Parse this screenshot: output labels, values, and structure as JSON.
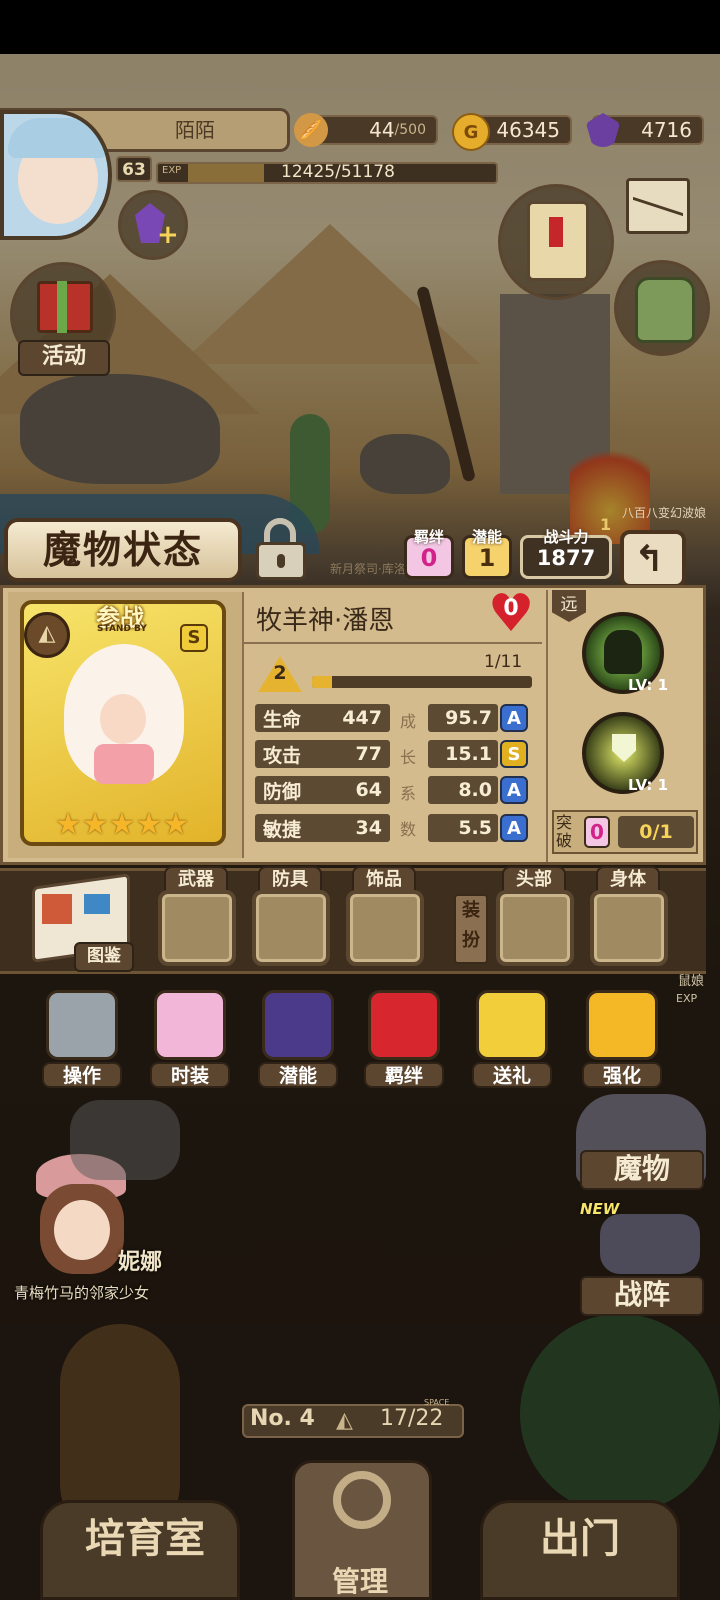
{
  "topbar": {
    "player_name": "陌陌",
    "level": "63",
    "exp_label": "EXP",
    "exp_text": "12425/51178",
    "exp_fraction": 0.243,
    "bread": "44",
    "bread_max": "/500",
    "gold_icon": "G",
    "gold": "46345",
    "gem": "4716"
  },
  "side_left": {
    "activity_label": "活动"
  },
  "panel_header": {
    "title": "魔物状态",
    "bond_label": "羁绊",
    "bond_value": "0",
    "potential_label": "潜能",
    "potential_value": "1",
    "power_label": "战斗力",
    "power_value": "1877",
    "bg_text_1": "新月祭司·库洛",
    "bg_text_2": "八百八变幻波娘",
    "bg_num": "1"
  },
  "monster": {
    "standby_label": "参战",
    "standby_sub": "STAND BY",
    "rank": "S",
    "stars": 5,
    "name": "牧羊神·潘恩",
    "heart_value": "0",
    "level": "2",
    "progress_text": "1/11",
    "progress_fraction": 0.091,
    "range_label": "远",
    "growth_chars": [
      "成",
      "长",
      "系",
      "数"
    ],
    "stats": [
      {
        "label": "生命",
        "value": "447",
        "growth": "95.7",
        "grade": "A",
        "grade_color": "#3a6fd0"
      },
      {
        "label": "攻击",
        "value": "77",
        "growth": "15.1",
        "grade": "S",
        "grade_color": "#e0b020"
      },
      {
        "label": "防御",
        "value": "64",
        "growth": "8.0",
        "grade": "A",
        "grade_color": "#3a6fd0"
      },
      {
        "label": "敏捷",
        "value": "34",
        "growth": "5.5",
        "grade": "A",
        "grade_color": "#3a6fd0"
      }
    ],
    "skills": [
      {
        "level": "LV: 1"
      },
      {
        "level": "LV: 1"
      }
    ],
    "breakthrough_label": "突破",
    "breakthrough_value": "0",
    "breakthrough_progress": "0/1"
  },
  "equipment": {
    "codex_label": "图鉴",
    "weapon": "武器",
    "armor": "防具",
    "accessory": "饰品",
    "dress_label": "装扮",
    "head": "头部",
    "body": "身体"
  },
  "actions": [
    {
      "label": "操作",
      "icon": "gear-icon"
    },
    {
      "label": "时装",
      "icon": "clothes-icon"
    },
    {
      "label": "潜能",
      "icon": "shadow-icon"
    },
    {
      "label": "羁绊",
      "icon": "hearts-icon"
    },
    {
      "label": "送礼",
      "icon": "gift-icon"
    },
    {
      "label": "强化",
      "icon": "up-arrows-icon"
    }
  ],
  "lower": {
    "npc_name": "妮娜",
    "npc_title": "青梅竹马的邻家少女",
    "monster_btn": "魔物",
    "formation_btn": "战阵",
    "new_tag": "NEW",
    "side_name": "鼠娘",
    "side_exp": "EXP",
    "room_no": "No. 4",
    "space_label": "SPACE",
    "space_value": "17/22",
    "nursery": "培育室",
    "manage": "管理",
    "exit": "出门"
  }
}
